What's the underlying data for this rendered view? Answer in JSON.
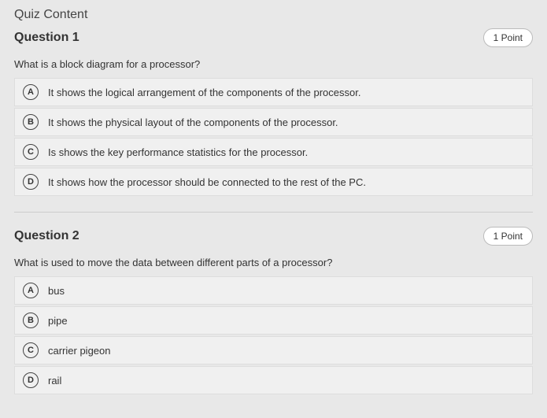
{
  "header": "Quiz Content",
  "questions": [
    {
      "title": "Question 1",
      "points": "1 Point",
      "text": "What is a block diagram for a processor?",
      "options": [
        {
          "letter": "A",
          "text": "It shows the logical arrangement of the components of the processor."
        },
        {
          "letter": "B",
          "text": "It shows the physical layout of the components of the processor."
        },
        {
          "letter": "C",
          "text": "Is shows the key performance statistics for the processor."
        },
        {
          "letter": "D",
          "text": "It shows how the processor should be connected to the rest of the PC."
        }
      ]
    },
    {
      "title": "Question 2",
      "points": "1 Point",
      "text": "What is used to move the data between different parts of a processor?",
      "options": [
        {
          "letter": "A",
          "text": "bus"
        },
        {
          "letter": "B",
          "text": "pipe"
        },
        {
          "letter": "C",
          "text": "carrier pigeon"
        },
        {
          "letter": "D",
          "text": "rail"
        }
      ]
    }
  ]
}
